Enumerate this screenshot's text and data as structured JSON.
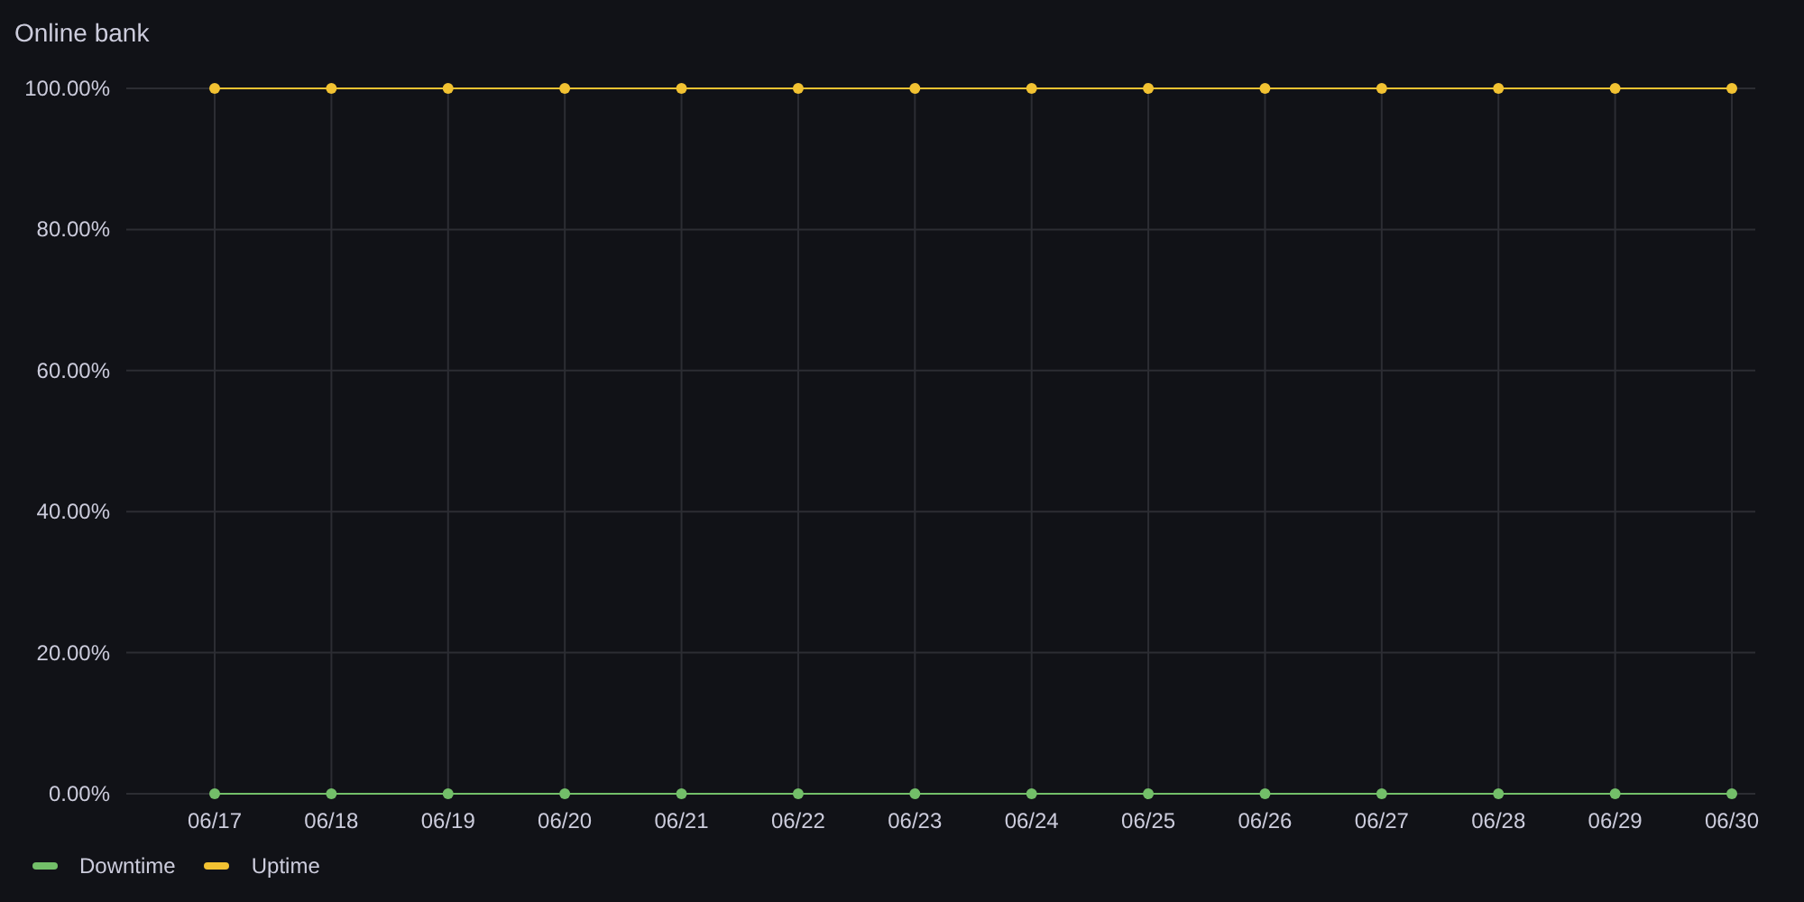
{
  "panel": {
    "title": "Online bank",
    "chart_data": {
      "type": "line",
      "categories": [
        "06/17",
        "06/18",
        "06/19",
        "06/20",
        "06/21",
        "06/22",
        "06/23",
        "06/24",
        "06/25",
        "06/26",
        "06/27",
        "06/28",
        "06/29",
        "06/30"
      ],
      "series": [
        {
          "name": "Downtime",
          "color": "#73bf69",
          "marker": "circle",
          "values": [
            0,
            0,
            0,
            0,
            0,
            0,
            0,
            0,
            0,
            0,
            0,
            0,
            0,
            0
          ]
        },
        {
          "name": "Uptime",
          "color": "#f2c232",
          "marker": "circle",
          "values": [
            100,
            100,
            100,
            100,
            100,
            100,
            100,
            100,
            100,
            100,
            100,
            100,
            100,
            100
          ]
        }
      ],
      "ylim": [
        0,
        100
      ],
      "grid": true,
      "yticks": [
        {
          "value": 0,
          "label": "0.00%"
        },
        {
          "value": 20,
          "label": "20.00%"
        },
        {
          "value": 40,
          "label": "40.00%"
        },
        {
          "value": 60,
          "label": "60.00%"
        },
        {
          "value": 80,
          "label": "80.00%"
        },
        {
          "value": 100,
          "label": "100.00%"
        }
      ]
    }
  }
}
